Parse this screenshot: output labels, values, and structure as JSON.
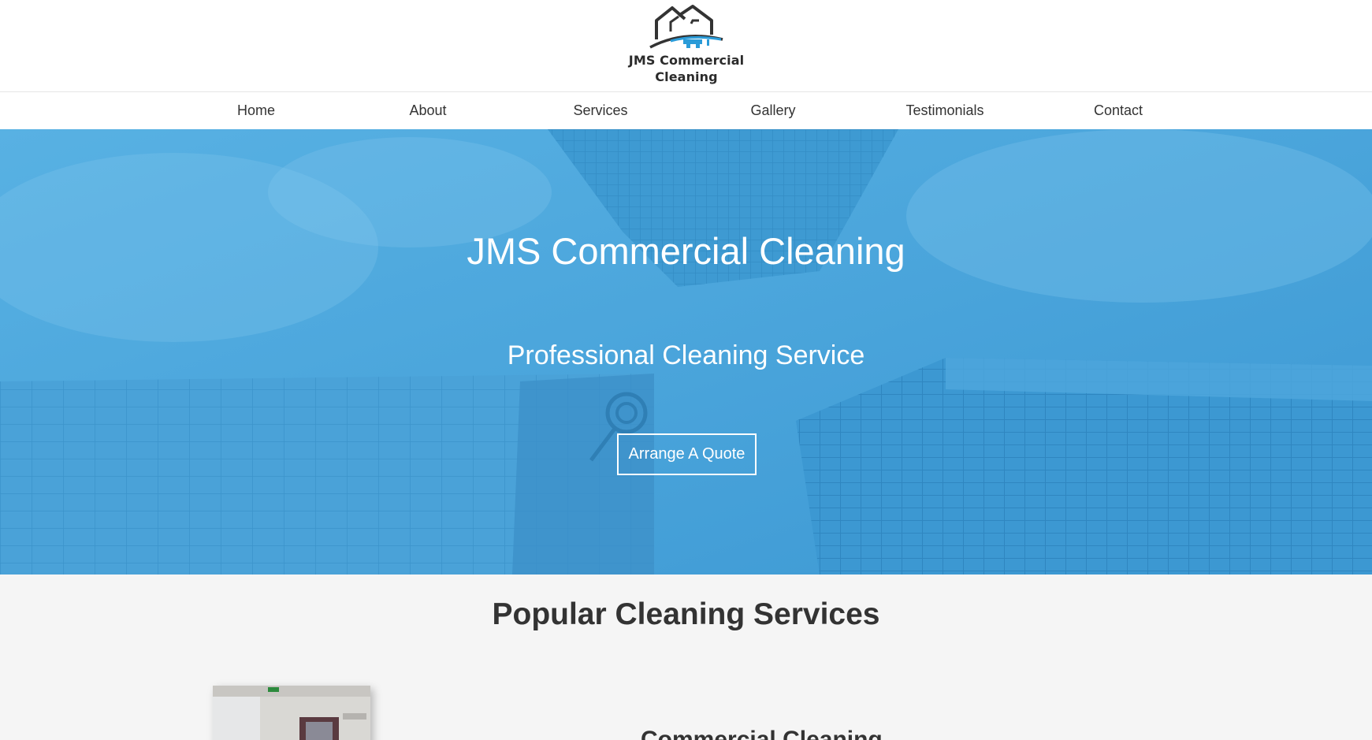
{
  "brand": {
    "logo_line1": "JMS Commercial",
    "logo_line2": "Cleaning",
    "accent_color": "#2a9bd8",
    "hero_color": "#4aa5dd"
  },
  "nav": {
    "items": [
      {
        "label": "Home"
      },
      {
        "label": "About"
      },
      {
        "label": "Services"
      },
      {
        "label": "Gallery"
      },
      {
        "label": "Testimonials"
      },
      {
        "label": "Contact"
      }
    ]
  },
  "hero": {
    "title": "JMS Commercial Cleaning",
    "subtitle": "Professional Cleaning Service",
    "cta_label": "Arrange A Quote"
  },
  "services": {
    "title": "Popular Cleaning Services",
    "items": [
      {
        "heading": "Commercial Cleaning"
      }
    ]
  }
}
